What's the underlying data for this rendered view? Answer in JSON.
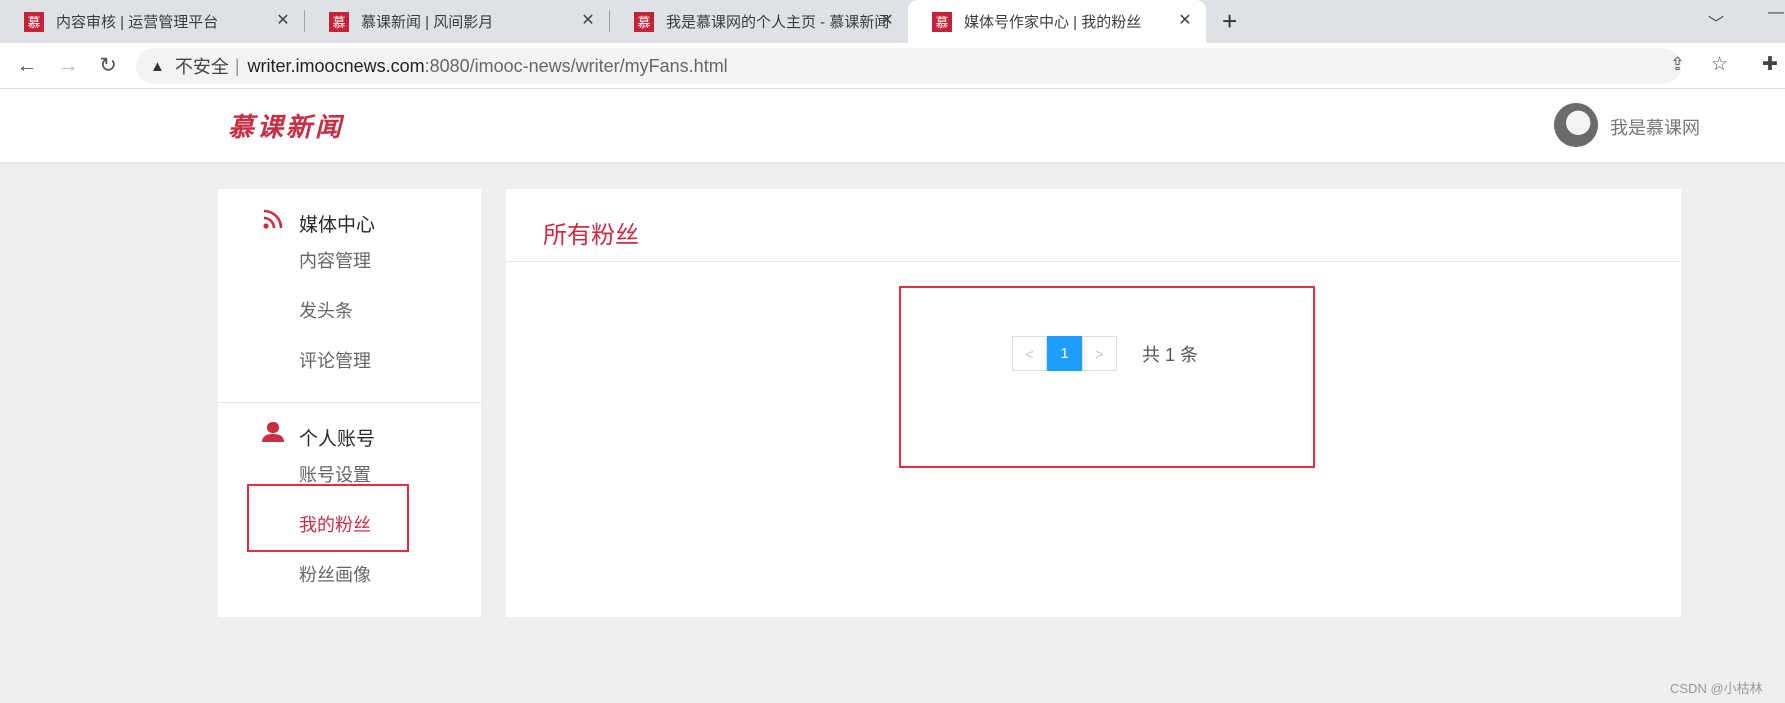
{
  "browser": {
    "tabs": [
      {
        "label": "内容审核 | 运营管理平台",
        "favicon": "慕"
      },
      {
        "label": "慕课新闻 | 风间影月",
        "favicon": "慕"
      },
      {
        "label": "我是慕课网的个人主页 - 慕课新闻",
        "favicon": "慕"
      },
      {
        "label": "媒体号作家中心 | 我的粉丝",
        "favicon": "慕"
      }
    ],
    "new_tab": "+",
    "address": {
      "security_label": "不安全",
      "host": "writer.imoocnews.com",
      "path": ":8080/imooc-news/writer/myFans.html"
    }
  },
  "header": {
    "logo": "慕课新闻",
    "user_name": "我是慕课网"
  },
  "sidebar": {
    "groups": [
      {
        "title": "媒体中心",
        "icon": "rss-icon",
        "items": [
          "内容管理",
          "发头条",
          "评论管理"
        ]
      },
      {
        "title": "个人账号",
        "icon": "user-icon",
        "items": [
          "账号设置",
          "我的粉丝",
          "粉丝画像"
        ]
      }
    ],
    "active_item": "我的粉丝"
  },
  "main": {
    "title": "所有粉丝",
    "pagination": {
      "prev": "<",
      "current_page": "1",
      "next": ">",
      "total_text": "共 1 条"
    }
  },
  "watermark": "CSDN @小枯林",
  "colors": {
    "brand": "#c82f44",
    "accent_blue": "#1e9fff",
    "highlight_border": "#e0303f"
  }
}
